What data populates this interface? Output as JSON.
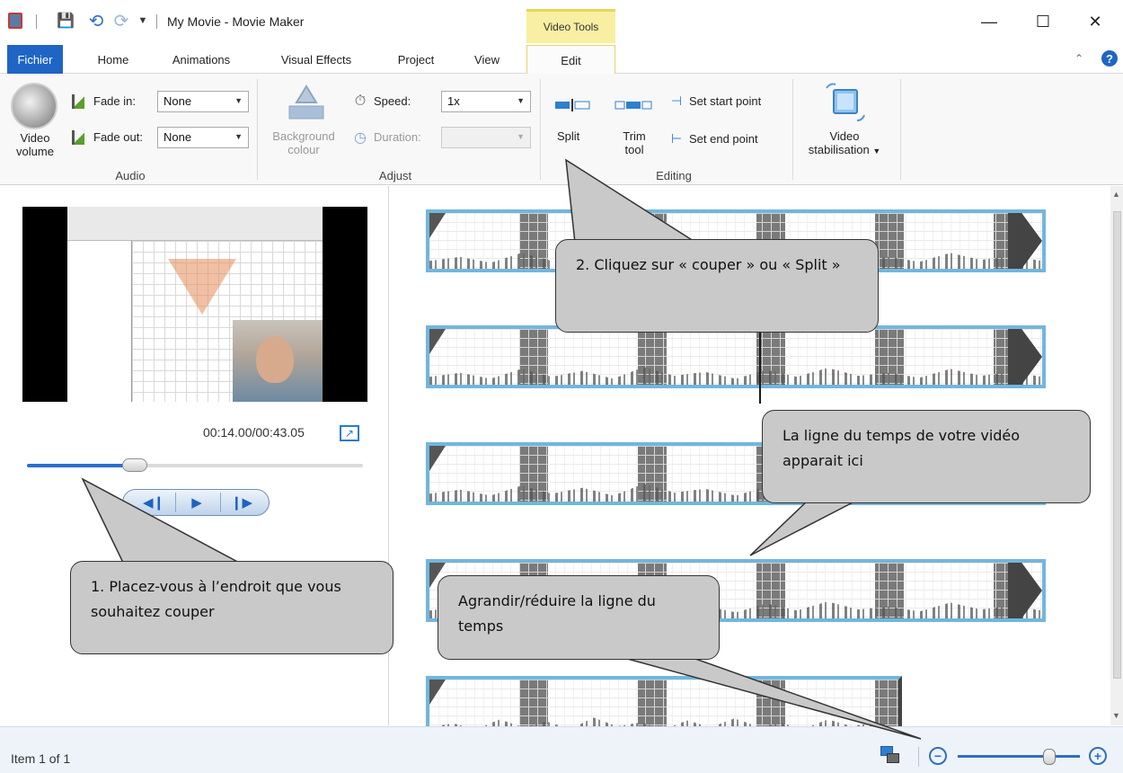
{
  "app": {
    "window_title": "My Movie - Movie Maker",
    "contextual_tab_header": "Video Tools"
  },
  "tabs": {
    "fichier": "Fichier",
    "home": "Home",
    "animations": "Animations",
    "visual_effects": "Visual Effects",
    "project": "Project",
    "view": "View",
    "edit": "Edit"
  },
  "ribbon": {
    "audio": {
      "video_volume_label": "Video volume",
      "fade_in_label": "Fade in:",
      "fade_in_value": "None",
      "fade_out_label": "Fade out:",
      "fade_out_value": "None",
      "group_label": "Audio"
    },
    "adjust": {
      "background_colour_label": "Background colour",
      "speed_label": "Speed:",
      "speed_value": "1x",
      "duration_label": "Duration:",
      "duration_value": "",
      "group_label": "Adjust"
    },
    "editing": {
      "split_label": "Split",
      "trim_tool_label": "Trim tool",
      "set_start_point_label": "Set start point",
      "set_end_point_label": "Set end point",
      "group_label": "Editing"
    },
    "stabilisation": {
      "label": "Video stabilisation"
    }
  },
  "preview": {
    "time_display": "00:14.00/00:43.05",
    "seek_position_fraction": 0.32
  },
  "status": {
    "item_text": "Item 1 of 1",
    "zoom_level_fraction": 0.75
  },
  "callouts": {
    "split": "2. Cliquez sur « couper » ou « Split »",
    "timeline": "La ligne du temps de votre vidéo apparait ici",
    "place": "1. Placez-vous à l’endroit que vous souhaitez couper",
    "zoom": "Agrandir/réduire la ligne du temps"
  },
  "icons": {
    "app": "movie-maker-icon",
    "save": "save-icon",
    "undo": "undo-icon",
    "redo": "redo-icon",
    "help": "help-icon",
    "storyboard": "storyboard-icon",
    "popout": "popout-icon"
  },
  "colors": {
    "fichier_tab": "#1f65c4",
    "contextual_header": "#f8efa2",
    "timeline_border": "#72b6dd",
    "callout_fill": "#c9c9c9",
    "accent": "#2f6fc0"
  }
}
